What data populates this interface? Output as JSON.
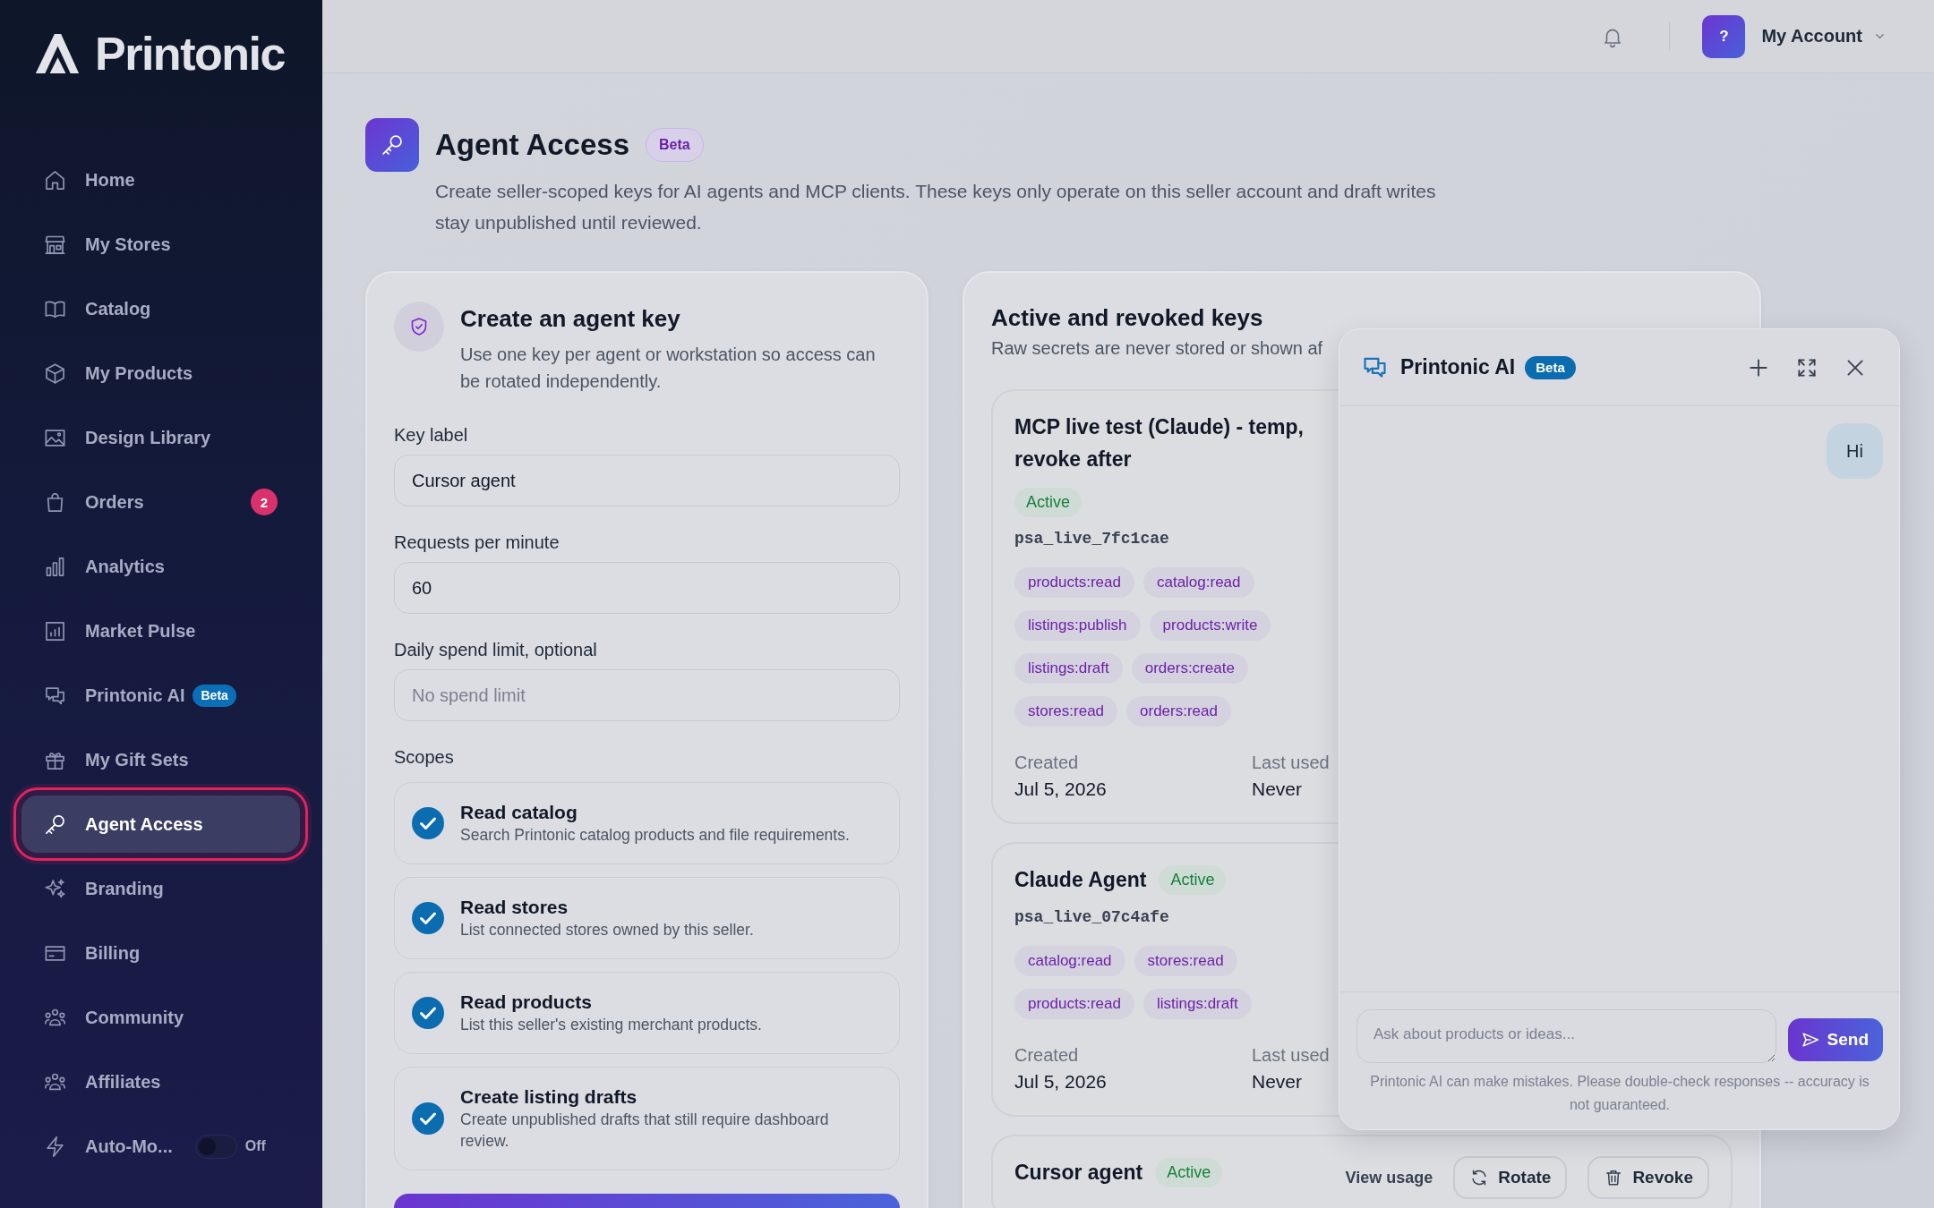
{
  "sidebar": {
    "logo": "Printonic",
    "items": [
      {
        "label": "Home",
        "kind": "link",
        "selected": false
      },
      {
        "label": "My Stores",
        "kind": "link",
        "selected": false
      },
      {
        "label": "Catalog",
        "kind": "link",
        "selected": false
      },
      {
        "label": "My Products",
        "kind": "link",
        "selected": false
      },
      {
        "label": "Design Library",
        "kind": "link",
        "selected": false
      },
      {
        "label": "Orders",
        "kind": "link",
        "selected": false,
        "badge": "2"
      },
      {
        "label": "Analytics",
        "kind": "link",
        "selected": false
      },
      {
        "label": "Market Pulse",
        "kind": "link",
        "selected": false
      },
      {
        "label": "Printonic AI",
        "kind": "link",
        "selected": false,
        "tag": "Beta"
      },
      {
        "label": "My Gift Sets",
        "kind": "link",
        "selected": false
      },
      {
        "label": "Agent Access",
        "kind": "link",
        "selected": true
      },
      {
        "label": "Branding",
        "kind": "link",
        "selected": false
      },
      {
        "label": "Billing",
        "kind": "link",
        "selected": false
      },
      {
        "label": "Community",
        "kind": "link",
        "selected": false
      },
      {
        "label": "Affiliates",
        "kind": "link",
        "selected": false
      },
      {
        "label": "Auto-Mo...",
        "kind": "toggle",
        "selected": false,
        "toggle": {
          "on": false,
          "label": "Off"
        }
      }
    ]
  },
  "header": {
    "account": {
      "avatar": "?",
      "label": "My Account"
    }
  },
  "page": {
    "title": "Agent Access",
    "badge": "Beta",
    "description": "Create seller-scoped keys for AI agents and MCP clients. These keys only operate on this seller account and draft writes stay unpublished until reviewed."
  },
  "create_card": {
    "title": "Create an agent key",
    "description": "Use one key per agent or workstation so access can be rotated independently.",
    "fields": [
      {
        "label": "Key label",
        "value": "Cursor agent"
      },
      {
        "label": "Requests per minute",
        "value": "60"
      },
      {
        "label": "Daily spend limit, optional",
        "placeholder": "No spend limit"
      }
    ],
    "scopes_label": "Scopes",
    "scopes": [
      {
        "title": "Read catalog",
        "description": "Search Printonic catalog products and file requirements.",
        "checked": true
      },
      {
        "title": "Read stores",
        "description": "List connected stores owned by this seller.",
        "checked": true
      },
      {
        "title": "Read products",
        "description": "List this seller's existing merchant products.",
        "checked": true
      },
      {
        "title": "Create listing drafts",
        "description": "Create unpublished drafts that still require dashboard review.",
        "checked": true
      }
    ]
  },
  "keys_card": {
    "title": "Active and revoked keys",
    "subtitle": "Raw secrets are never stored or shown af",
    "keys": [
      {
        "name": "MCP live test (Claude) - temp, revoke after",
        "status": {
          "label": "Active",
          "kind": "active"
        },
        "prefix": "psa_live_7fc1cae",
        "scopes": [
          "products:read",
          "catalog:read",
          "listings:publish",
          "products:write",
          "listings:draft",
          "orders:create",
          "stores:read",
          "orders:read"
        ],
        "created": {
          "label": "Created",
          "value": "Jul 5, 2026"
        },
        "last_used": {
          "label": "Last used",
          "value": "Never"
        }
      },
      {
        "name": "Claude Agent",
        "status": {
          "label": "Active",
          "kind": "active"
        },
        "prefix": "psa_live_07c4afe",
        "scopes": [
          "catalog:read",
          "stores:read",
          "products:read",
          "listings:draft"
        ],
        "created": {
          "label": "Created",
          "value": "Jul 5, 2026"
        },
        "last_used": {
          "label": "Last used",
          "value": "Never"
        }
      },
      {
        "name": "Cursor agent",
        "status": {
          "label": "Active",
          "kind": "active"
        },
        "actions": {
          "view": "View usage",
          "rotate": "Rotate",
          "revoke": "Revoke"
        }
      }
    ]
  },
  "chat": {
    "title": "Printonic AI",
    "badge": "Beta",
    "messages": [
      {
        "kind": "user",
        "text": "Hi"
      }
    ],
    "input": {
      "placeholder": "Ask about products or ideas..."
    },
    "send": "Send",
    "disclaimer": "Printonic AI can make mistakes. Please double-check responses -- accuracy is not guaranteed."
  }
}
